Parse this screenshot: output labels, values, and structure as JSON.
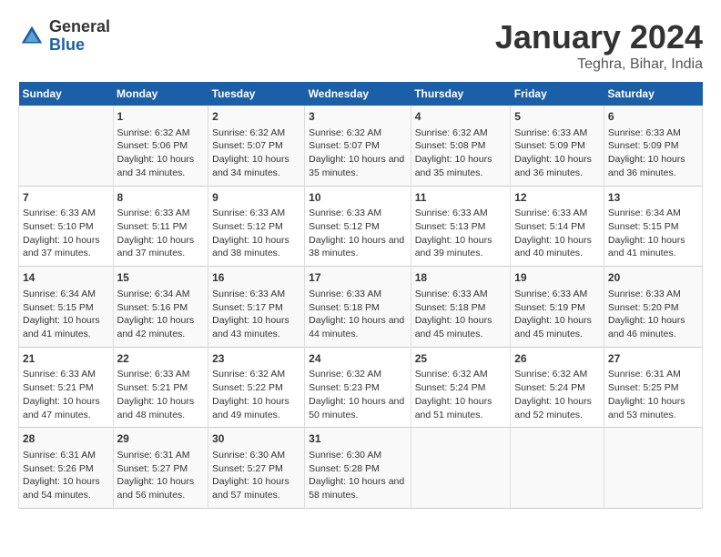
{
  "logo": {
    "general": "General",
    "blue": "Blue"
  },
  "title": "January 2024",
  "location": "Teghra, Bihar, India",
  "days_of_week": [
    "Sunday",
    "Monday",
    "Tuesday",
    "Wednesday",
    "Thursday",
    "Friday",
    "Saturday"
  ],
  "weeks": [
    [
      {
        "day": "",
        "sunrise": "",
        "sunset": "",
        "daylight": ""
      },
      {
        "day": "1",
        "sunrise": "Sunrise: 6:32 AM",
        "sunset": "Sunset: 5:06 PM",
        "daylight": "Daylight: 10 hours and 34 minutes."
      },
      {
        "day": "2",
        "sunrise": "Sunrise: 6:32 AM",
        "sunset": "Sunset: 5:07 PM",
        "daylight": "Daylight: 10 hours and 34 minutes."
      },
      {
        "day": "3",
        "sunrise": "Sunrise: 6:32 AM",
        "sunset": "Sunset: 5:07 PM",
        "daylight": "Daylight: 10 hours and 35 minutes."
      },
      {
        "day": "4",
        "sunrise": "Sunrise: 6:32 AM",
        "sunset": "Sunset: 5:08 PM",
        "daylight": "Daylight: 10 hours and 35 minutes."
      },
      {
        "day": "5",
        "sunrise": "Sunrise: 6:33 AM",
        "sunset": "Sunset: 5:09 PM",
        "daylight": "Daylight: 10 hours and 36 minutes."
      },
      {
        "day": "6",
        "sunrise": "Sunrise: 6:33 AM",
        "sunset": "Sunset: 5:09 PM",
        "daylight": "Daylight: 10 hours and 36 minutes."
      }
    ],
    [
      {
        "day": "7",
        "sunrise": "Sunrise: 6:33 AM",
        "sunset": "Sunset: 5:10 PM",
        "daylight": "Daylight: 10 hours and 37 minutes."
      },
      {
        "day": "8",
        "sunrise": "Sunrise: 6:33 AM",
        "sunset": "Sunset: 5:11 PM",
        "daylight": "Daylight: 10 hours and 37 minutes."
      },
      {
        "day": "9",
        "sunrise": "Sunrise: 6:33 AM",
        "sunset": "Sunset: 5:12 PM",
        "daylight": "Daylight: 10 hours and 38 minutes."
      },
      {
        "day": "10",
        "sunrise": "Sunrise: 6:33 AM",
        "sunset": "Sunset: 5:12 PM",
        "daylight": "Daylight: 10 hours and 38 minutes."
      },
      {
        "day": "11",
        "sunrise": "Sunrise: 6:33 AM",
        "sunset": "Sunset: 5:13 PM",
        "daylight": "Daylight: 10 hours and 39 minutes."
      },
      {
        "day": "12",
        "sunrise": "Sunrise: 6:33 AM",
        "sunset": "Sunset: 5:14 PM",
        "daylight": "Daylight: 10 hours and 40 minutes."
      },
      {
        "day": "13",
        "sunrise": "Sunrise: 6:34 AM",
        "sunset": "Sunset: 5:15 PM",
        "daylight": "Daylight: 10 hours and 41 minutes."
      }
    ],
    [
      {
        "day": "14",
        "sunrise": "Sunrise: 6:34 AM",
        "sunset": "Sunset: 5:15 PM",
        "daylight": "Daylight: 10 hours and 41 minutes."
      },
      {
        "day": "15",
        "sunrise": "Sunrise: 6:34 AM",
        "sunset": "Sunset: 5:16 PM",
        "daylight": "Daylight: 10 hours and 42 minutes."
      },
      {
        "day": "16",
        "sunrise": "Sunrise: 6:33 AM",
        "sunset": "Sunset: 5:17 PM",
        "daylight": "Daylight: 10 hours and 43 minutes."
      },
      {
        "day": "17",
        "sunrise": "Sunrise: 6:33 AM",
        "sunset": "Sunset: 5:18 PM",
        "daylight": "Daylight: 10 hours and 44 minutes."
      },
      {
        "day": "18",
        "sunrise": "Sunrise: 6:33 AM",
        "sunset": "Sunset: 5:18 PM",
        "daylight": "Daylight: 10 hours and 45 minutes."
      },
      {
        "day": "19",
        "sunrise": "Sunrise: 6:33 AM",
        "sunset": "Sunset: 5:19 PM",
        "daylight": "Daylight: 10 hours and 45 minutes."
      },
      {
        "day": "20",
        "sunrise": "Sunrise: 6:33 AM",
        "sunset": "Sunset: 5:20 PM",
        "daylight": "Daylight: 10 hours and 46 minutes."
      }
    ],
    [
      {
        "day": "21",
        "sunrise": "Sunrise: 6:33 AM",
        "sunset": "Sunset: 5:21 PM",
        "daylight": "Daylight: 10 hours and 47 minutes."
      },
      {
        "day": "22",
        "sunrise": "Sunrise: 6:33 AM",
        "sunset": "Sunset: 5:21 PM",
        "daylight": "Daylight: 10 hours and 48 minutes."
      },
      {
        "day": "23",
        "sunrise": "Sunrise: 6:32 AM",
        "sunset": "Sunset: 5:22 PM",
        "daylight": "Daylight: 10 hours and 49 minutes."
      },
      {
        "day": "24",
        "sunrise": "Sunrise: 6:32 AM",
        "sunset": "Sunset: 5:23 PM",
        "daylight": "Daylight: 10 hours and 50 minutes."
      },
      {
        "day": "25",
        "sunrise": "Sunrise: 6:32 AM",
        "sunset": "Sunset: 5:24 PM",
        "daylight": "Daylight: 10 hours and 51 minutes."
      },
      {
        "day": "26",
        "sunrise": "Sunrise: 6:32 AM",
        "sunset": "Sunset: 5:24 PM",
        "daylight": "Daylight: 10 hours and 52 minutes."
      },
      {
        "day": "27",
        "sunrise": "Sunrise: 6:31 AM",
        "sunset": "Sunset: 5:25 PM",
        "daylight": "Daylight: 10 hours and 53 minutes."
      }
    ],
    [
      {
        "day": "28",
        "sunrise": "Sunrise: 6:31 AM",
        "sunset": "Sunset: 5:26 PM",
        "daylight": "Daylight: 10 hours and 54 minutes."
      },
      {
        "day": "29",
        "sunrise": "Sunrise: 6:31 AM",
        "sunset": "Sunset: 5:27 PM",
        "daylight": "Daylight: 10 hours and 56 minutes."
      },
      {
        "day": "30",
        "sunrise": "Sunrise: 6:30 AM",
        "sunset": "Sunset: 5:27 PM",
        "daylight": "Daylight: 10 hours and 57 minutes."
      },
      {
        "day": "31",
        "sunrise": "Sunrise: 6:30 AM",
        "sunset": "Sunset: 5:28 PM",
        "daylight": "Daylight: 10 hours and 58 minutes."
      },
      {
        "day": "",
        "sunrise": "",
        "sunset": "",
        "daylight": ""
      },
      {
        "day": "",
        "sunrise": "",
        "sunset": "",
        "daylight": ""
      },
      {
        "day": "",
        "sunrise": "",
        "sunset": "",
        "daylight": ""
      }
    ]
  ]
}
